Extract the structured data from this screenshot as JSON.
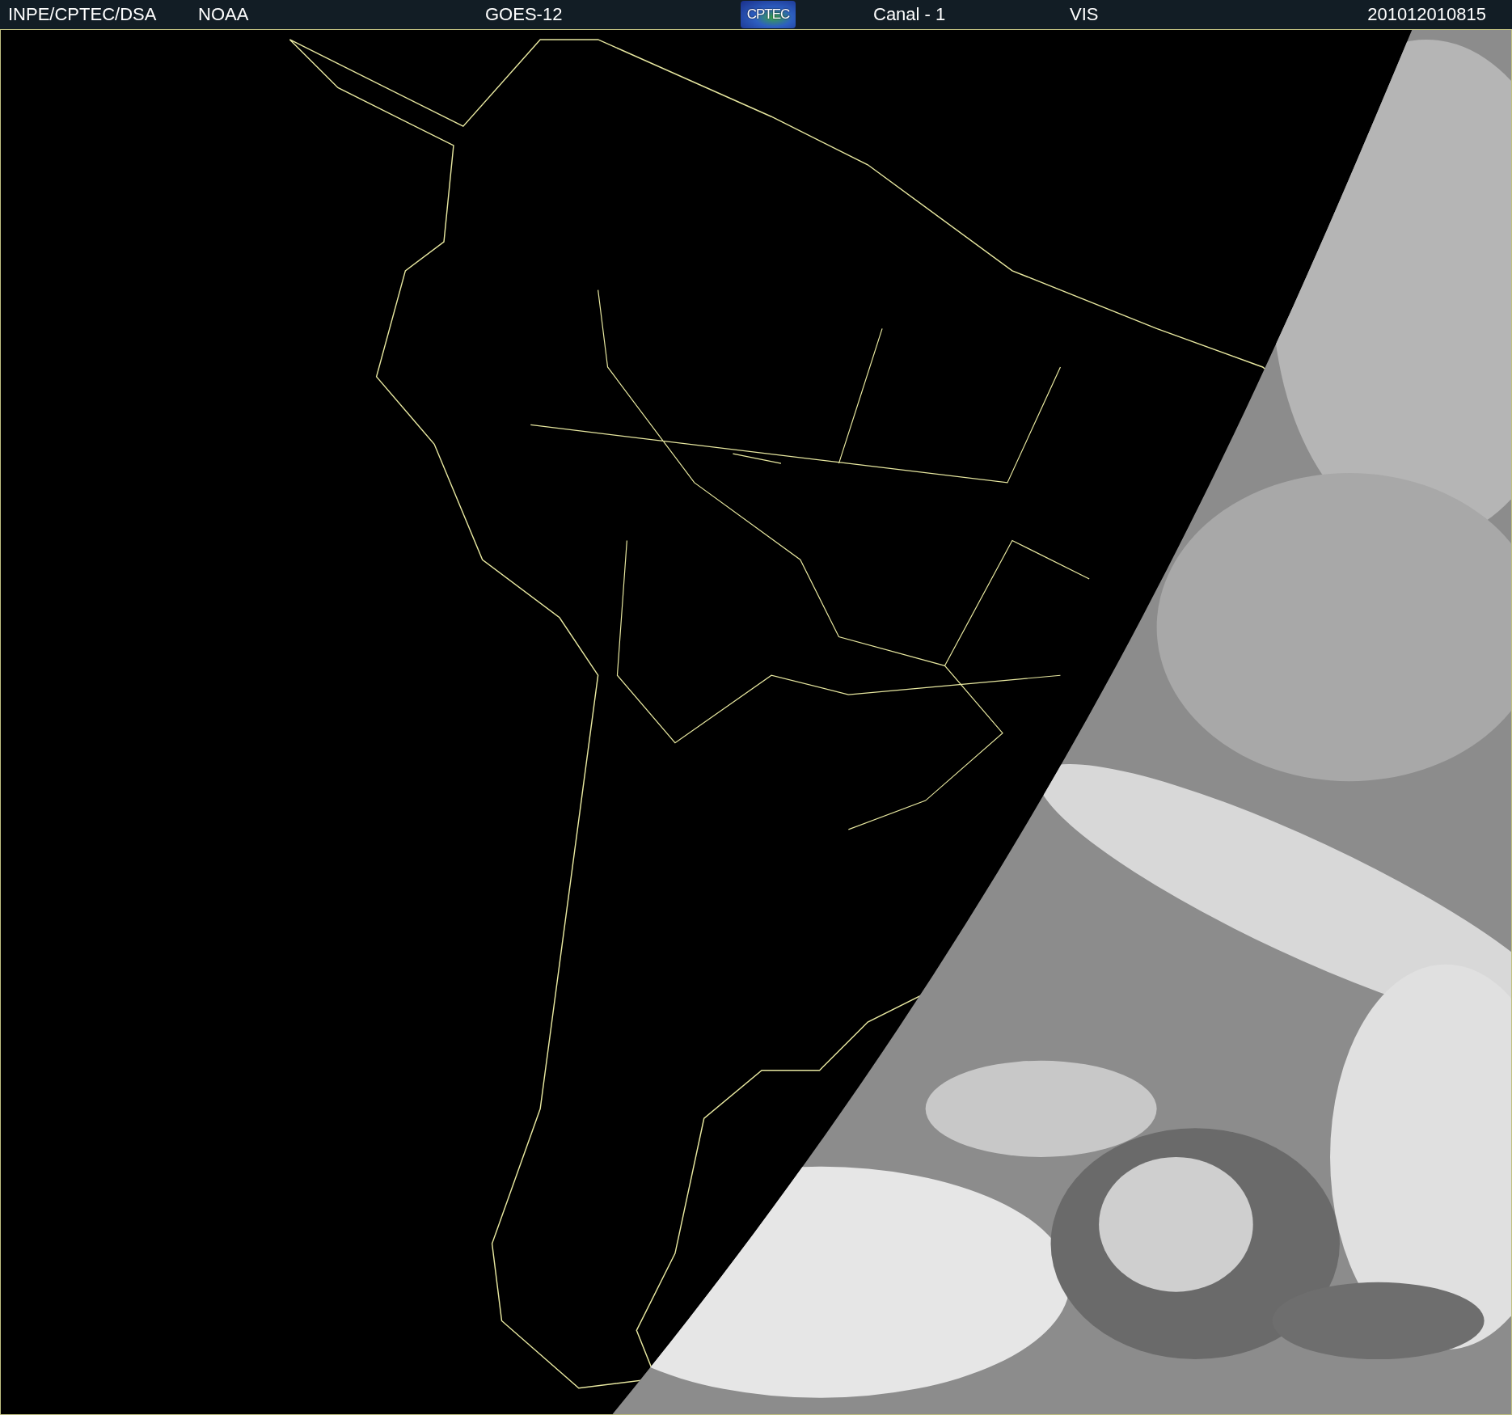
{
  "header": {
    "items": [
      {
        "kind": "text",
        "text": "INPE/CPTEC/DSA"
      },
      {
        "kind": "text",
        "text": "NOAA"
      },
      {
        "kind": "text",
        "text": "GOES-12"
      },
      {
        "kind": "logo",
        "text": "CPTEC"
      },
      {
        "kind": "text",
        "text": "Canal - 1"
      },
      {
        "kind": "text",
        "text": "VIS"
      },
      {
        "kind": "text",
        "text": "201012010815"
      }
    ]
  }
}
